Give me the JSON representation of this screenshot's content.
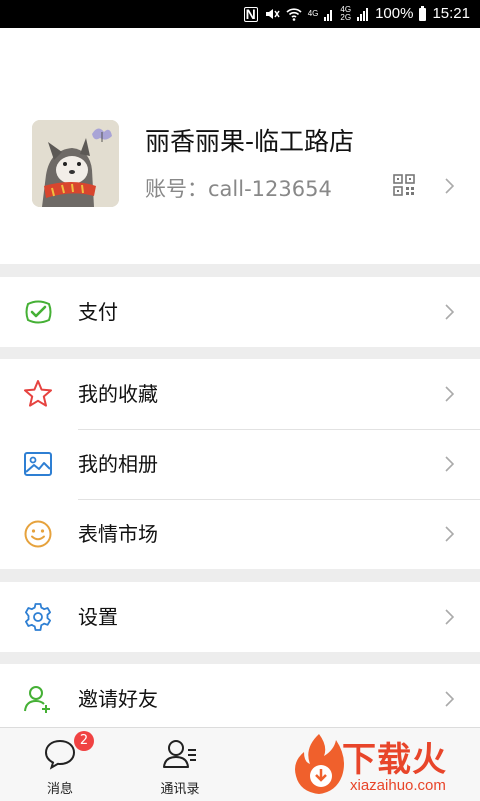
{
  "status_bar": {
    "network_top": "4G",
    "network_2a": "4G",
    "network_2b": "2G",
    "battery": "100%",
    "time": "15:21"
  },
  "profile": {
    "name": "丽香丽果-临工路店",
    "account": "账号：call-123654"
  },
  "menu": {
    "pay": "支付",
    "favorites": "我的收藏",
    "album": "我的相册",
    "stickers": "表情市场",
    "settings": "设置",
    "invite": "邀请好友"
  },
  "tabbar": {
    "messages": "消息",
    "messages_badge": "2",
    "contacts": "通讯录"
  },
  "watermark": {
    "brand": "下载火",
    "domain": "xiazaihuo.com"
  },
  "colors": {
    "green": "#45b035",
    "red": "#e64340",
    "blue": "#2e7fd3",
    "orange": "#e6a23c",
    "badge": "#f04242"
  }
}
